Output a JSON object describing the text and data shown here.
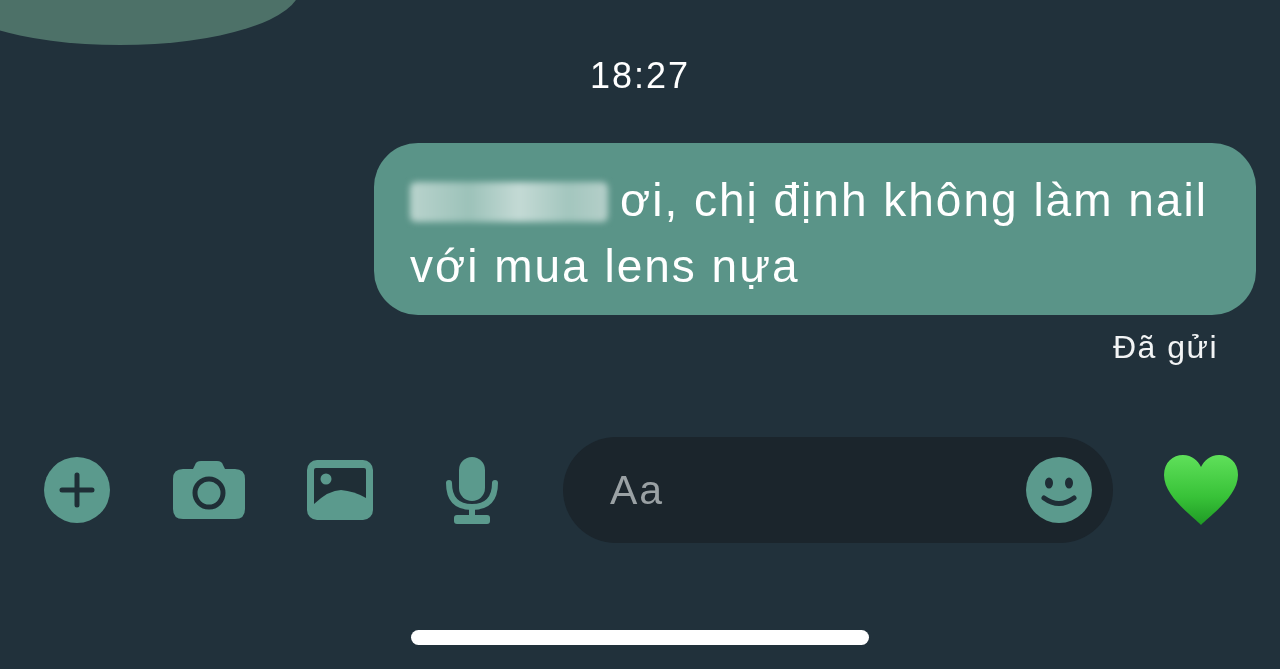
{
  "timestamp": "18:27",
  "messages": [
    {
      "kind": "outgoing",
      "redacted_prefix": true,
      "text": "ơi, chị định không làm nail với mua lens nựa",
      "status": "Đã gửi"
    }
  ],
  "composer": {
    "placeholder": "Aa"
  }
}
